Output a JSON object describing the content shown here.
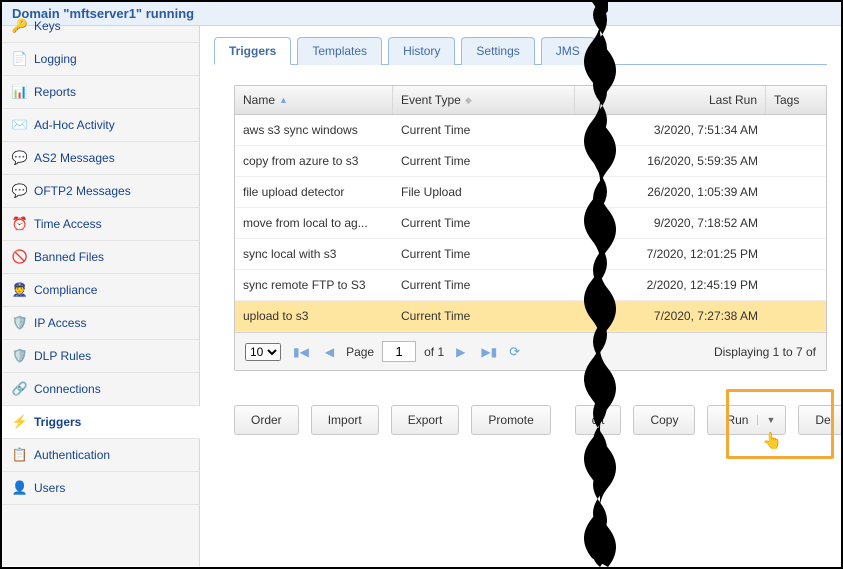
{
  "header": {
    "title": "Domain \"mftserver1\" running"
  },
  "sidebar": {
    "items": [
      {
        "label": "Keys",
        "icon": "🔑"
      },
      {
        "label": "Logging",
        "icon": "📄"
      },
      {
        "label": "Reports",
        "icon": "📊"
      },
      {
        "label": "Ad-Hoc Activity",
        "icon": "✉️"
      },
      {
        "label": "AS2 Messages",
        "icon": "💬"
      },
      {
        "label": "OFTP2 Messages",
        "icon": "💬"
      },
      {
        "label": "Time Access",
        "icon": "⏰"
      },
      {
        "label": "Banned Files",
        "icon": "🚫"
      },
      {
        "label": "Compliance",
        "icon": "👮"
      },
      {
        "label": "IP Access",
        "icon": "🛡️"
      },
      {
        "label": "DLP Rules",
        "icon": "🛡️"
      },
      {
        "label": "Connections",
        "icon": "🔗"
      },
      {
        "label": "Triggers",
        "icon": "⚡"
      },
      {
        "label": "Authentication",
        "icon": "📋"
      },
      {
        "label": "Users",
        "icon": "👤"
      }
    ]
  },
  "tabs": {
    "items": [
      {
        "label": "Triggers"
      },
      {
        "label": "Templates"
      },
      {
        "label": "History"
      },
      {
        "label": "Settings"
      },
      {
        "label": "JMS"
      }
    ]
  },
  "grid": {
    "columns": {
      "name": "Name",
      "event": "Event Type",
      "last": "Last Run",
      "tags": "Tags"
    },
    "rows": [
      {
        "name": "aws s3 sync windows",
        "event": "Current Time",
        "last": "3/2020, 7:51:34 AM",
        "tags": ""
      },
      {
        "name": "copy from azure to s3",
        "event": "Current Time",
        "last": "16/2020, 5:59:35 AM",
        "tags": ""
      },
      {
        "name": "file upload detector",
        "event": "File Upload",
        "last": "26/2020, 1:05:39 AM",
        "tags": ""
      },
      {
        "name": "move from local to ag...",
        "event": "Current Time",
        "last": "9/2020, 7:18:52 AM",
        "tags": ""
      },
      {
        "name": "sync local with s3",
        "event": "Current Time",
        "last": "7/2020, 12:01:25 PM",
        "tags": ""
      },
      {
        "name": "sync remote FTP to S3",
        "event": "Current Time",
        "last": "2/2020, 12:45:19 PM",
        "tags": ""
      },
      {
        "name": "upload to s3",
        "event": "Current Time",
        "last": "7/2020, 7:27:38 AM",
        "tags": ""
      }
    ],
    "selectedIndex": 6
  },
  "paging": {
    "pageSize": "10",
    "pageLabel": "Page",
    "pageNumber": "1",
    "ofLabel": "of 1",
    "displayText": "Displaying 1 to 7 of"
  },
  "actions": {
    "order": "Order",
    "import": "Import",
    "export": "Export",
    "promote": "Promote",
    "edit": "dit",
    "copy": "Copy",
    "run": "Run",
    "delete": "De"
  }
}
